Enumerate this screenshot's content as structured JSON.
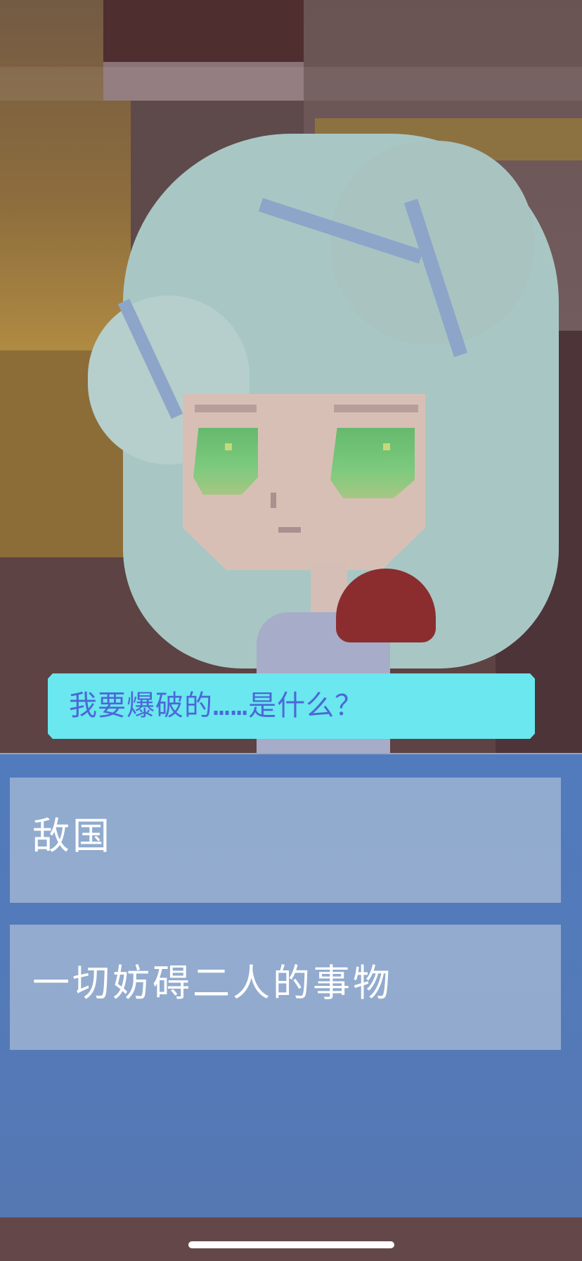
{
  "speech": {
    "text": "我要爆破的……是什么？"
  },
  "choices": [
    {
      "label": "敌国"
    },
    {
      "label": "一切妨碍二人的事物"
    }
  ],
  "palette": {
    "speech_bubble": "#6ae7ef",
    "speech_text": "#4b68d7",
    "choice_panel": "#bdcbdc",
    "menu_panel": "#5082cd",
    "background_wall": "#5e4a4b",
    "hair": "#a8c7c4",
    "eyes": "#7dca7e",
    "ribbon": "#8b2d2f"
  }
}
